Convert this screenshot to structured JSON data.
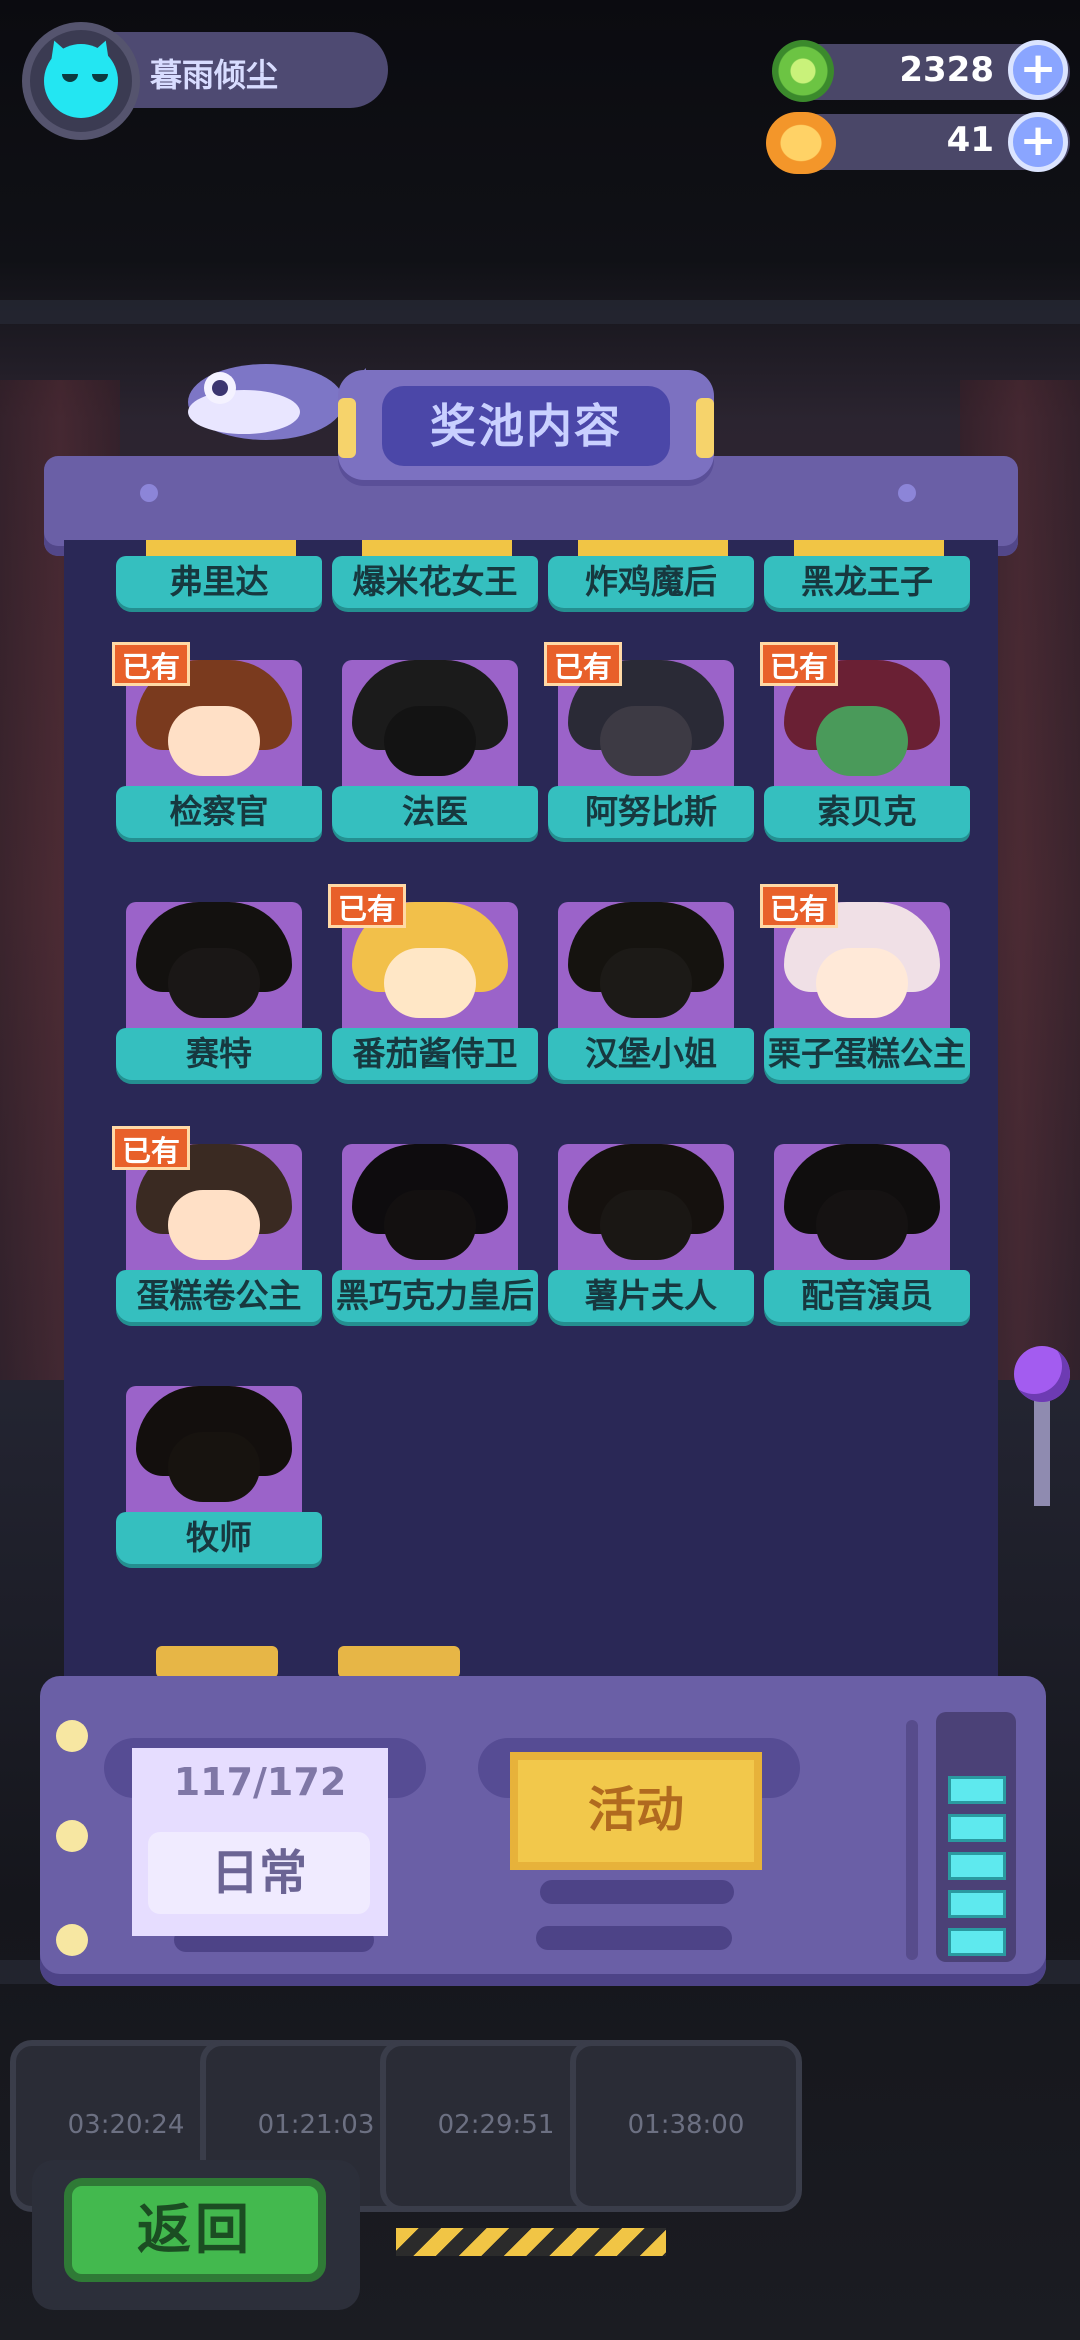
{
  "profile": {
    "username": "暮雨倾尘"
  },
  "currencies": [
    {
      "name": "green-gem",
      "value": "2328",
      "color": "#7ed957"
    },
    {
      "name": "planet-coin",
      "value": "41",
      "color": "#f7a531"
    }
  ],
  "panel": {
    "title": "奖池内容",
    "owned_label": "已有"
  },
  "partial_row": [
    "弗里达",
    "爆米花女王",
    "炸鸡魔后",
    "黑龙王子"
  ],
  "characters": [
    {
      "name": "检察官",
      "owned": true
    },
    {
      "name": "法医",
      "owned": false
    },
    {
      "name": "阿努比斯",
      "owned": true
    },
    {
      "name": "索贝克",
      "owned": true
    },
    {
      "name": "赛特",
      "owned": false
    },
    {
      "name": "番茄酱侍卫",
      "owned": true
    },
    {
      "name": "汉堡小姐",
      "owned": false
    },
    {
      "name": "栗子蛋糕公主",
      "owned": true
    },
    {
      "name": "蛋糕卷公主",
      "owned": true
    },
    {
      "name": "黑巧克力皇后",
      "owned": false
    },
    {
      "name": "薯片夫人",
      "owned": false
    },
    {
      "name": "配音演员",
      "owned": false
    },
    {
      "name": "牧师",
      "owned": false
    }
  ],
  "tabs": {
    "count": "117/172",
    "daily": "日常",
    "event": "活动"
  },
  "back_label": "返回",
  "background": {
    "timers": [
      "03:20:24",
      "01:21:03",
      "02:29:51",
      "01:38:00"
    ]
  }
}
